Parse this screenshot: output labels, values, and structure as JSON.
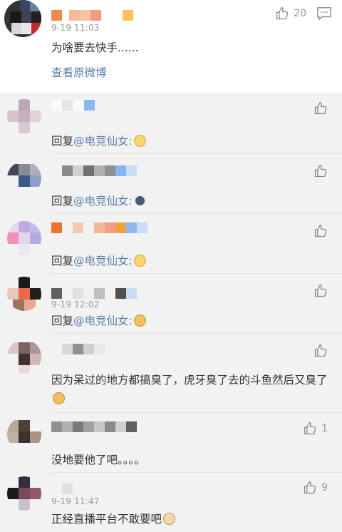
{
  "main_comment": {
    "timestamp": "9-19 11:03",
    "text": "为啥要去快手......",
    "like_count": "20",
    "view_link": "查看原微博"
  },
  "replies": [
    {
      "prefix": "回复",
      "mention": "@电竞仙女:",
      "text": "",
      "emoji": "smile-emoji",
      "like_count": ""
    },
    {
      "prefix": "回复",
      "mention": "@电竞仙女:",
      "text": "",
      "emoji": "husky-emoji",
      "like_count": ""
    },
    {
      "prefix": "回复",
      "mention": "@电竞仙女:",
      "text": "",
      "emoji": "grin-emoji",
      "like_count": ""
    },
    {
      "timestamp": "9-19 12:02",
      "prefix": "回复",
      "mention": "@电竞仙女:",
      "text": "",
      "emoji": "dog-emoji",
      "like_count": ""
    },
    {
      "prefix": "",
      "mention": "",
      "text": "因为呆过的地方都搞臭了，虎牙臭了去的斗鱼然后又臭了",
      "emoji": "dog-emoji",
      "like_count": ""
    },
    {
      "prefix": "",
      "mention": "",
      "text": "没地要他了吧。。。。",
      "emoji": "",
      "like_count": "1"
    },
    {
      "timestamp": "9-19 11:47",
      "prefix": "",
      "mention": "",
      "text": "正经直播平台不敢要吧",
      "emoji": "cat-emoji",
      "like_count": "9"
    }
  ]
}
